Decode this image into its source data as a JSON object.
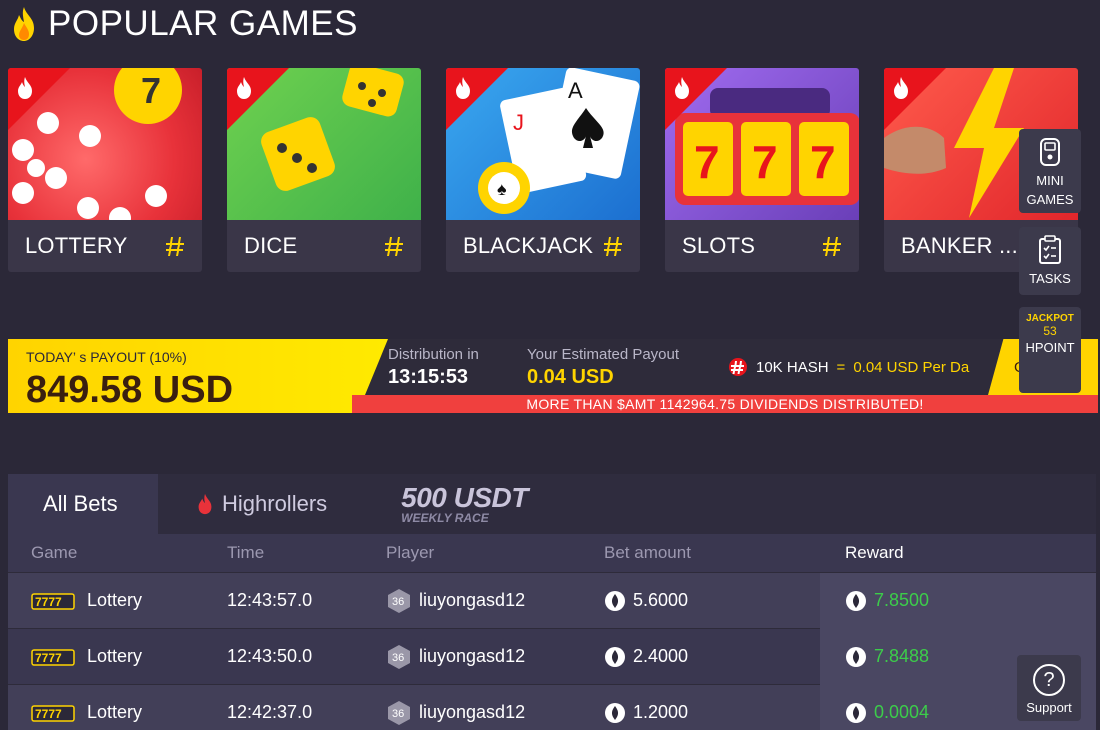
{
  "header": {
    "title": "POPULAR GAMES",
    "icon": "flame-icon"
  },
  "games": [
    {
      "label": "LOTTERY",
      "art": "lottery-art",
      "accent": "#e8323a"
    },
    {
      "label": "DICE",
      "art": "dice-art",
      "accent": "#3fb14a"
    },
    {
      "label": "BLACKJACK",
      "art": "blackjack-art",
      "accent": "#1c6fd0"
    },
    {
      "label": "SLOTS",
      "art": "slots-art",
      "accent": "#6a3fb8"
    },
    {
      "label": "BANKER ...",
      "art": "banker-art",
      "accent": "#e1262b"
    }
  ],
  "payout": {
    "today_label": "TODAY’ s PAYOUT (10%)",
    "amount": "849.58 USD",
    "distribution_label": "Distribution in",
    "distribution_time": "13:15:53",
    "estimated_label": "Your Estimated Payout",
    "estimated_value": "0.04 USD",
    "hash_label": "10K HASH",
    "hash_eq": "=",
    "hash_value": "0.04 USD Per Da",
    "get_label": "Get",
    "ribbon": "MORE THAN $AMT 1142964.75 DIVIDENDS DISTRIBUTED!"
  },
  "side": {
    "mini_games": [
      "MINI",
      "GAMES"
    ],
    "tasks": "TASKS",
    "jackpot_badge": "JACKPOT",
    "hpoint_count": "53",
    "hpoint": "HPOINT",
    "support": "Support"
  },
  "bets": {
    "tab_all": "All Bets",
    "tab_highrollers": "Highrollers",
    "race_big": "500 USDT",
    "race_small": "WEEKLY RACE",
    "columns": [
      "Game",
      "Time",
      "Player",
      "Bet amount",
      "Reward"
    ],
    "rows": [
      {
        "game": "Lottery",
        "time": "12:43:57.0",
        "level": "36",
        "player": "liuyongasd12",
        "bet": "5.6000",
        "reward": "7.8500"
      },
      {
        "game": "Lottery",
        "time": "12:43:50.0",
        "level": "36",
        "player": "liuyongasd12",
        "bet": "2.4000",
        "reward": "7.8488"
      },
      {
        "game": "Lottery",
        "time": "12:42:37.0",
        "level": "36",
        "player": "liuyongasd12",
        "bet": "1.2000",
        "reward": "0.0004"
      }
    ]
  },
  "colors": {
    "background": "#2b2838",
    "accent_yellow": "#ffd400",
    "reward_green": "#3ccd4a",
    "ribbon_red": "#f0403e"
  }
}
